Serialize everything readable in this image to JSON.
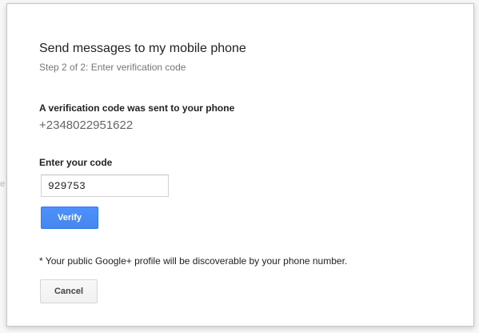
{
  "background": {
    "stray_char": "e"
  },
  "dialog": {
    "title": "Send messages to my mobile phone",
    "subtitle": "Step 2 of 2: Enter verification code",
    "sent_label": "A verification code was sent to your phone",
    "phone_number": "+2348022951622",
    "code_label": "Enter your code",
    "code_value": "929753",
    "verify_label": "Verify",
    "note": "* Your public Google+ profile will be discoverable by your phone number.",
    "cancel_label": "Cancel"
  },
  "colors": {
    "primary_button": "#4d90fe",
    "dialog_border": "#c6c6c6"
  }
}
